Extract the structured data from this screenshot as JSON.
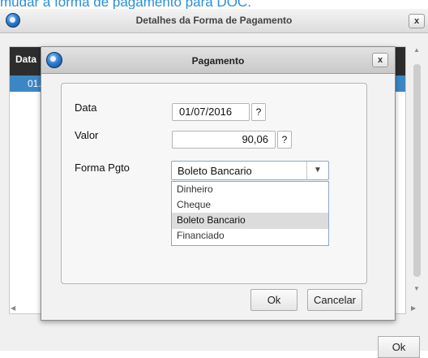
{
  "caption": "mudar a forma de pagamento para DOC.",
  "outer_window": {
    "title": "Detalhes da Forma de Pagamento",
    "close_label": "x",
    "grid": {
      "header_label": "Data",
      "selected_row_text": "01."
    },
    "ok_label": "Ok"
  },
  "modal": {
    "title": "Pagamento",
    "close_label": "x",
    "fields": {
      "data_label": "Data",
      "data_value": "01/07/2016",
      "valor_label": "Valor",
      "valor_value": "90,06",
      "forma_label": "Forma Pgto",
      "forma_value": "Boleto Bancario",
      "lookup_label": "?"
    },
    "dropdown_options": [
      "Dinheiro",
      "Cheque",
      "Boleto Bancario",
      "Financiado"
    ],
    "ok_label": "Ok",
    "cancel_label": "Cancelar"
  },
  "colors": {
    "caption": "#2a8fd6",
    "grid_header": "#2d2d2d",
    "selected_row": "#3d86c4"
  },
  "icons": {
    "app": "app-logo-icon",
    "close": "close-icon",
    "dropdown": "chevron-down-icon"
  }
}
